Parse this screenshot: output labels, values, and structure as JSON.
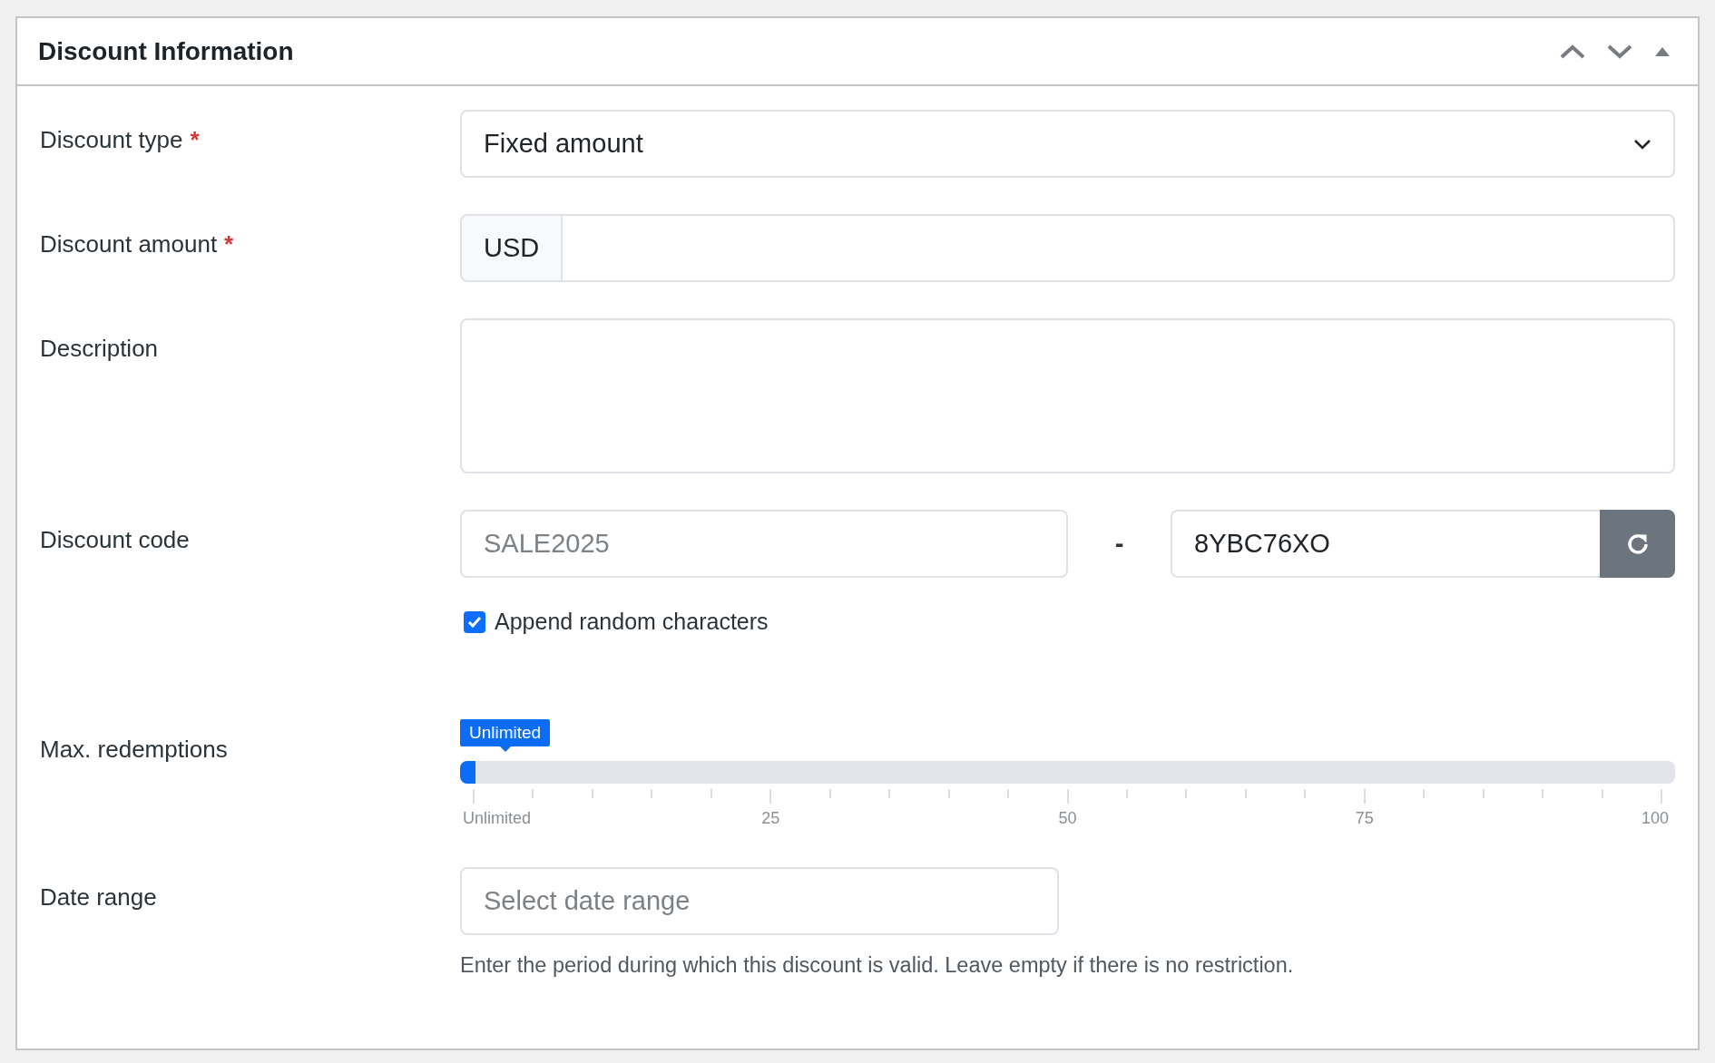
{
  "panel": {
    "title": "Discount Information",
    "collapsed": false
  },
  "fields": [
    {
      "kind": "select",
      "label": "Discount type",
      "required_mark": "*",
      "value": "Fixed amount"
    },
    {
      "kind": "amount",
      "label": "Discount amount",
      "required_mark": "*",
      "prefix": "USD"
    },
    {
      "kind": "textarea",
      "label": "Description"
    },
    {
      "kind": "code",
      "label": "Discount code",
      "placeholder": "SALE2025",
      "separator": "-",
      "suffix_value": "8YBC76XO",
      "append_random": {
        "label": "Append random characters",
        "checked": true
      }
    },
    {
      "kind": "slider",
      "label": "Max. redemptions",
      "level": 0,
      "tooltip": "Unlimited",
      "tick_labels": [
        "Unlimited",
        "25",
        "50",
        "75",
        "100"
      ]
    },
    {
      "kind": "date",
      "label": "Date range",
      "placeholder": "Select date range",
      "help": "Enter the period during which this discount is valid. Leave empty if there is no restriction."
    }
  ]
}
